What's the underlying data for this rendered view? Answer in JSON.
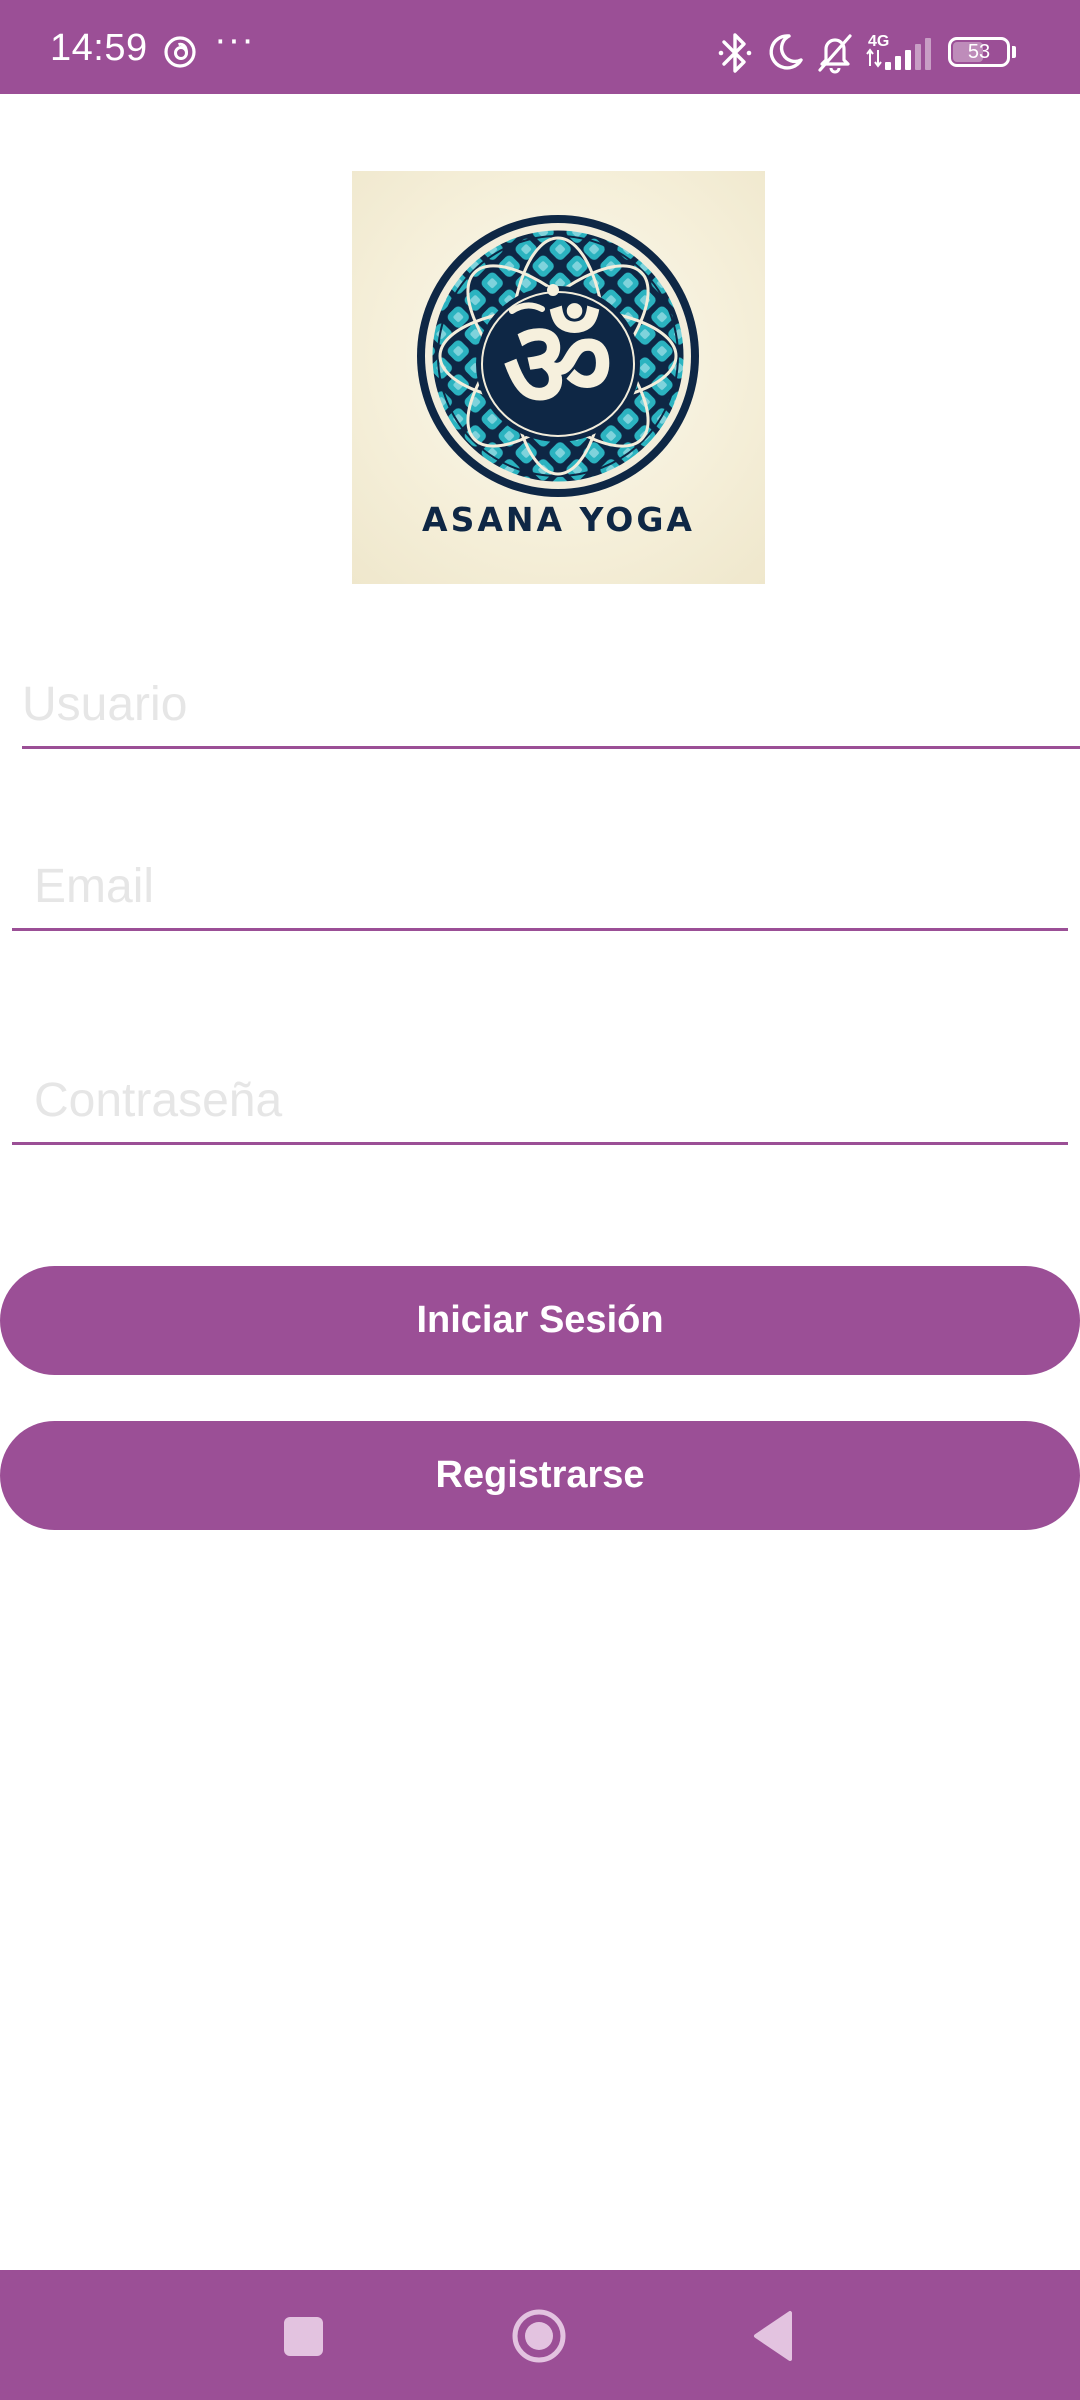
{
  "status_bar": {
    "time": "14:59",
    "overflow_dots": "···",
    "network": "4G",
    "battery": "53",
    "icons": [
      "threads-icon",
      "bluetooth-icon",
      "do-not-disturb-icon",
      "notifications-off-icon",
      "signal-icon",
      "battery-icon"
    ]
  },
  "logo": {
    "text": "ASANA YOGA",
    "icon": "om-mandala-icon"
  },
  "form": {
    "username_placeholder": "Usuario",
    "username_value": "",
    "email_placeholder": "Email",
    "email_value": "",
    "password_placeholder": "Contraseña",
    "password_value": ""
  },
  "buttons": {
    "login_label": "Iniciar Sesión",
    "register_label": "Registrarse"
  },
  "nav_bar": {
    "icons": [
      "recents-icon",
      "home-icon",
      "back-icon"
    ]
  },
  "colors": {
    "accent": "#9b4f96",
    "logo_navy": "#0e2745",
    "logo_teal": "#2bb3c0",
    "logo_background": "#f5efd9"
  }
}
